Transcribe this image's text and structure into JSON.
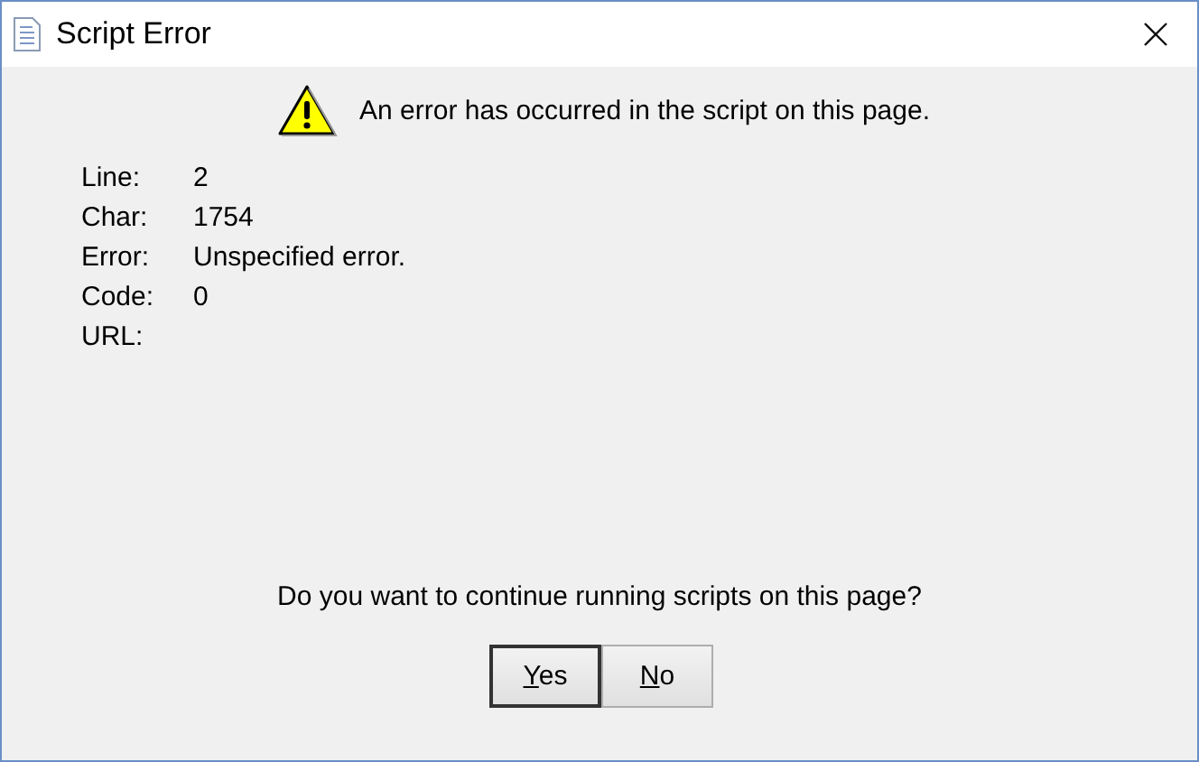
{
  "window": {
    "title": "Script Error"
  },
  "message": "An error has occurred in the script on this page.",
  "details": [
    {
      "label": "Line:",
      "value": "2"
    },
    {
      "label": "Char:",
      "value": "1754"
    },
    {
      "label": "Error:",
      "value": "Unspecified error."
    },
    {
      "label": "Code:",
      "value": "0"
    },
    {
      "label": "URL:"
    }
  ],
  "question": "Do you want to continue running scripts on this page?",
  "buttons": [
    {
      "label": "Yes",
      "selected": true
    },
    {
      "label": "No",
      "selected": false
    }
  ]
}
